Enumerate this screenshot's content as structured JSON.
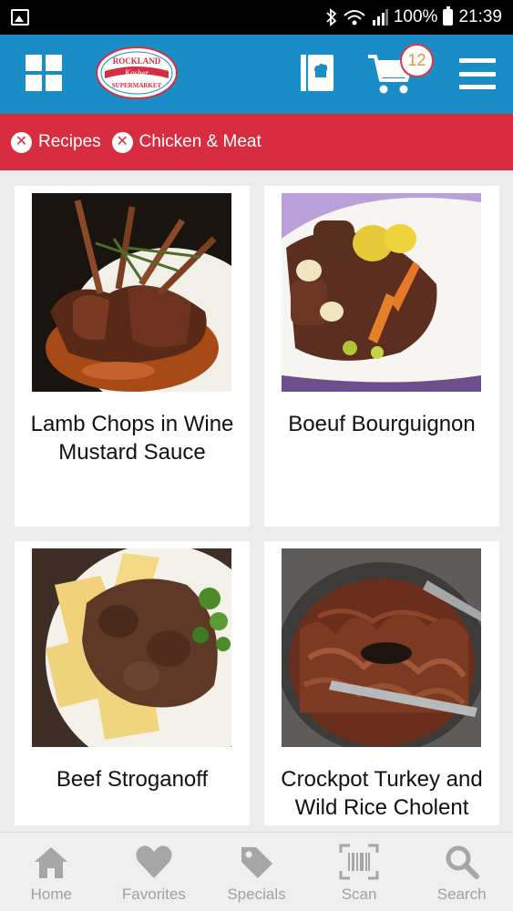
{
  "status_bar": {
    "battery": "100%",
    "time": "21:39"
  },
  "header": {
    "logo_text": [
      "ROCKLAND",
      "Kosher",
      "SUPERMARKET"
    ],
    "cart_count": "12",
    "brand_color": "#1a8cc6"
  },
  "filters": {
    "color": "#d82d41",
    "chips": [
      {
        "label": "Recipes"
      },
      {
        "label": "Chicken & Meat"
      }
    ]
  },
  "recipes": [
    {
      "title": "Lamb Chops in Wine Mustard Sauce"
    },
    {
      "title": "Boeuf Bourguignon"
    },
    {
      "title": "Beef Stroganoff"
    },
    {
      "title": "Crockpot Turkey and Wild Rice Cholent"
    }
  ],
  "bottom_nav": {
    "items": [
      {
        "label": "Home",
        "icon": "home-icon"
      },
      {
        "label": "Favorites",
        "icon": "heart-icon"
      },
      {
        "label": "Specials",
        "icon": "tag-icon"
      },
      {
        "label": "Scan",
        "icon": "barcode-scan-icon"
      },
      {
        "label": "Search",
        "icon": "search-icon"
      }
    ]
  }
}
